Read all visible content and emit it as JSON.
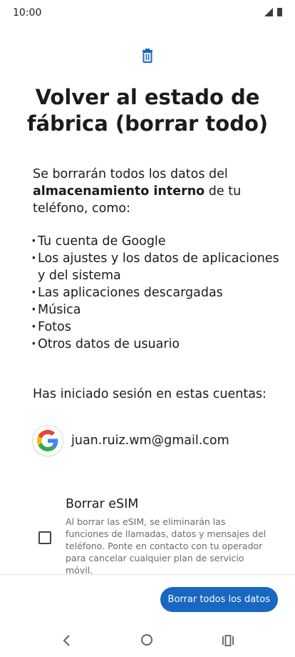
{
  "status_bar": {
    "time": "10:00"
  },
  "header": {
    "icon": "trash-icon",
    "title": "Volver al estado de fábrica (borrar todo)"
  },
  "intro": {
    "prefix": "Se borrarán todos los datos del ",
    "bold": "almacenamiento interno",
    "suffix": " de tu teléfono, como:"
  },
  "data_items": [
    "Tu cuenta de Google",
    "Los ajustes y los datos de aplicaciones y del sistema",
    "Las aplicaciones descargadas",
    "Música",
    "Fotos",
    "Otros datos de usuario"
  ],
  "accounts": {
    "label": "Has iniciado sesión en estas cuentas:",
    "items": [
      {
        "icon": "google-logo-icon",
        "email": "juan.ruiz.wm@gmail.com"
      }
    ]
  },
  "esim": {
    "title": "Borrar eSIM",
    "description": "Al borrar las eSIM, se eliminarán las funciones de llamadas, datos y mensajes del teléfono. Ponte en contacto con tu operador para cancelar cualquier plan de servicio móvil.",
    "checked": false
  },
  "actions": {
    "erase_label": "Borrar todos los datos"
  },
  "colors": {
    "accent": "#1867c0",
    "text": "#1b1b1f",
    "secondary_text": "#6b6b70"
  }
}
